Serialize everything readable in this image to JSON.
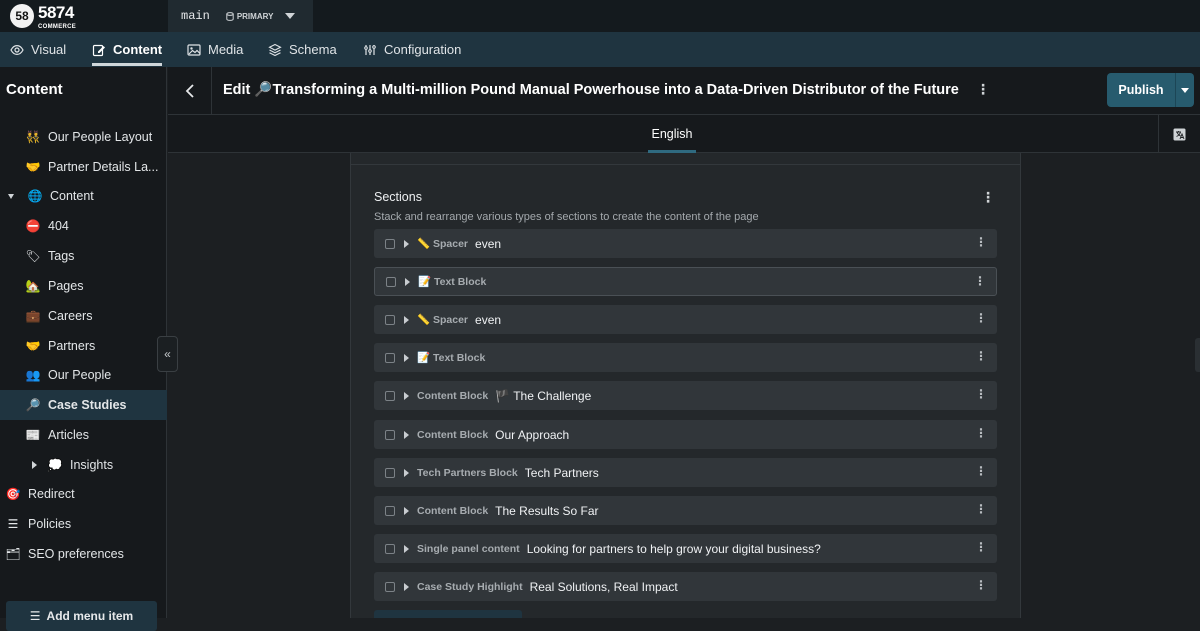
{
  "brand": {
    "logo_mark": "58",
    "logo_name": "5874",
    "logo_sub": "COMMERCE"
  },
  "branch": {
    "name": "main",
    "tag": "PRIMARY"
  },
  "tabs": [
    {
      "label": "Visual",
      "icon": "eye-icon"
    },
    {
      "label": "Content",
      "icon": "edit-icon",
      "active": true
    },
    {
      "label": "Media",
      "icon": "image-icon"
    },
    {
      "label": "Schema",
      "icon": "layers-icon"
    },
    {
      "label": "Configuration",
      "icon": "config-icon"
    }
  ],
  "sidebar": {
    "title": "Content",
    "items": [
      {
        "emoji": "👯",
        "label": "Our People Layout"
      },
      {
        "emoji": "🤝",
        "label": "Partner Details La..."
      },
      {
        "emoji": "🌐",
        "label": "Content",
        "expander": "down"
      },
      {
        "emoji": "⛔",
        "label": "404"
      },
      {
        "emoji": "🏷",
        "label": "Tags"
      },
      {
        "emoji": "🏡",
        "label": "Pages"
      },
      {
        "emoji": "💼",
        "label": "Careers"
      },
      {
        "emoji": "🤝",
        "label": "Partners"
      },
      {
        "emoji": "👥",
        "label": "Our People"
      },
      {
        "emoji": "🔎",
        "label": "Case Studies",
        "active": true
      },
      {
        "emoji": "📰",
        "label": "Articles"
      },
      {
        "emoji": "💭",
        "label": "Insights",
        "expander": "right"
      },
      {
        "emoji": "🎯",
        "label": "Redirect"
      },
      {
        "emoji": "☰",
        "label": "Policies"
      },
      {
        "emoji": "🗂",
        "label": "SEO preferences"
      }
    ],
    "add_button": "Add menu item"
  },
  "header": {
    "title": "Edit 🔎Transforming a Multi-million Pound Manual Powerhouse into a Data-Driven Distributor of the Future",
    "publish_label": "Publish"
  },
  "locale": {
    "active": "English"
  },
  "sections": {
    "label": "Sections",
    "description": "Stack and rearrange various types of sections to create the content of the page",
    "rows": [
      {
        "type": "📏 Spacer",
        "label": "even"
      },
      {
        "type": "📝 Text Block",
        "label": "",
        "outlined": true
      },
      {
        "type": "📏 Spacer",
        "label": "even"
      },
      {
        "type": "📝 Text Block",
        "label": ""
      },
      {
        "type": "Content Block",
        "label": "🏴 The Challenge"
      },
      {
        "type": "Content Block",
        "label": "Our Approach"
      },
      {
        "type": "Tech Partners Block",
        "label": "Tech Partners"
      },
      {
        "type": "Content Block",
        "label": "The Results So Far"
      },
      {
        "type": "Single panel content",
        "label": "Looking for partners to help grow your digital business?"
      },
      {
        "type": "Case Study Highlight",
        "label": "Real Solutions, Real Impact"
      }
    ]
  }
}
